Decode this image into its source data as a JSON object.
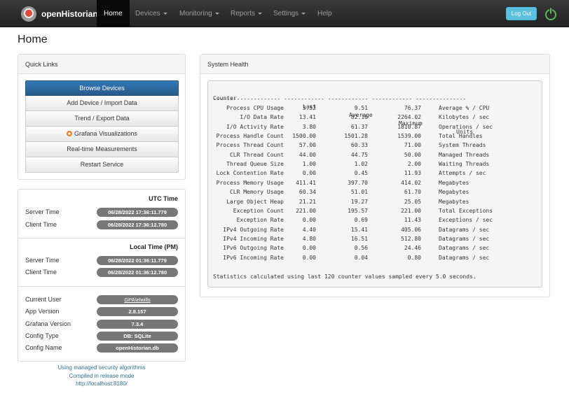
{
  "navbar": {
    "brand": "openHistorian",
    "items": [
      {
        "label": "Home",
        "active": true,
        "dropdown": false
      },
      {
        "label": "Devices",
        "dropdown": true
      },
      {
        "label": "Monitoring",
        "dropdown": true
      },
      {
        "label": "Reports",
        "dropdown": true
      },
      {
        "label": "Settings",
        "dropdown": true
      },
      {
        "label": "Help",
        "dropdown": false
      }
    ],
    "logout_label": "Log Out"
  },
  "page_title": "Home",
  "quick_links": {
    "title": "Quick Links",
    "buttons": [
      "Browse Devices",
      "Add Device / Import Data",
      "Trend / Export Data",
      "Grafana Visualizations",
      "Real-time Measurements",
      "Restart Service"
    ]
  },
  "utc": {
    "title": "UTC Time",
    "server_label": "Server Time",
    "server_value": "06/28/2022 17:36:11.779",
    "client_label": "Client Time",
    "client_value": "06/28/2022 17:36:12.780"
  },
  "local": {
    "title": "Local Time (PM)",
    "server_label": "Server Time",
    "server_value": "06/28/2022 01:36:11.779",
    "client_label": "Client Time",
    "client_value": "06/28/2022 01:36:12.780"
  },
  "info": {
    "rows": [
      {
        "label": "Current User",
        "value": "GPA\\elwills",
        "link": true
      },
      {
        "label": "App Version",
        "value": "2.8.157"
      },
      {
        "label": "Grafana Version",
        "value": "7.3.4"
      },
      {
        "label": "Config Type",
        "value": "DB: SQLite"
      },
      {
        "label": "Config Name",
        "value": "openHistorian.db"
      }
    ]
  },
  "footer": {
    "line1": "Using managed security algorithms",
    "line2": "Compiled in release mode",
    "line3": "http://localhost:8180/"
  },
  "system_health": {
    "title": "System Health",
    "headers": [
      "Counter",
      "Last",
      "Average",
      "Maximum",
      "Units"
    ],
    "separator": "-------------------- ------------ ------------ ------------ ---------------",
    "rows": [
      [
        "Process CPU Usage",
        "3.52",
        "9.51",
        "76.37",
        "Average % / CPU"
      ],
      [
        "I/O Data Rate",
        "13.41",
        "82.16",
        "2264.02",
        "Kilobytes / sec"
      ],
      [
        "I/O Activity Rate",
        "3.80",
        "61.37",
        "1810.87",
        "Operations / sec"
      ],
      [
        "Process Handle Count",
        "1500.00",
        "1501.28",
        "1539.00",
        "Total Handles"
      ],
      [
        "Process Thread Count",
        "57.00",
        "60.33",
        "71.00",
        "System Threads"
      ],
      [
        "CLR Thread Count",
        "44.00",
        "44.75",
        "50.00",
        "Managed Threads"
      ],
      [
        "Thread Queue Size",
        "1.00",
        "1.02",
        "2.00",
        "Waiting Threads"
      ],
      [
        "Lock Contention Rate",
        "0.00",
        "0.45",
        "11.93",
        "Attempts / sec"
      ],
      [
        "Process Memory Usage",
        "411.41",
        "397.70",
        "414.02",
        "Megabytes"
      ],
      [
        "CLR Memory Usage",
        "60.34",
        "51.01",
        "61.70",
        "Megabytes"
      ],
      [
        "Large Object Heap",
        "21.21",
        "19.27",
        "25.05",
        "Megabytes"
      ],
      [
        "Exception Count",
        "221.00",
        "195.57",
        "221.00",
        "Total Exceptions"
      ],
      [
        "Exception Rate",
        "0.00",
        "0.69",
        "11.43",
        "Exceptions / sec"
      ],
      [
        "IPv4 Outgoing Rate",
        "4.40",
        "15.41",
        "405.06",
        "Datagrams / sec"
      ],
      [
        "IPv4 Incoming Rate",
        "4.80",
        "16.51",
        "512.80",
        "Datagrams / sec"
      ],
      [
        "IPv6 Outgoing Rate",
        "0.00",
        "0.56",
        "24.46",
        "Datagrams / sec"
      ],
      [
        "IPv6 Incoming Rate",
        "0.00",
        "0.04",
        "0.80",
        "Datagrams / sec"
      ]
    ],
    "footnote": "Statistics calculated using last 120 counter values sampled every 5.0 seconds."
  }
}
